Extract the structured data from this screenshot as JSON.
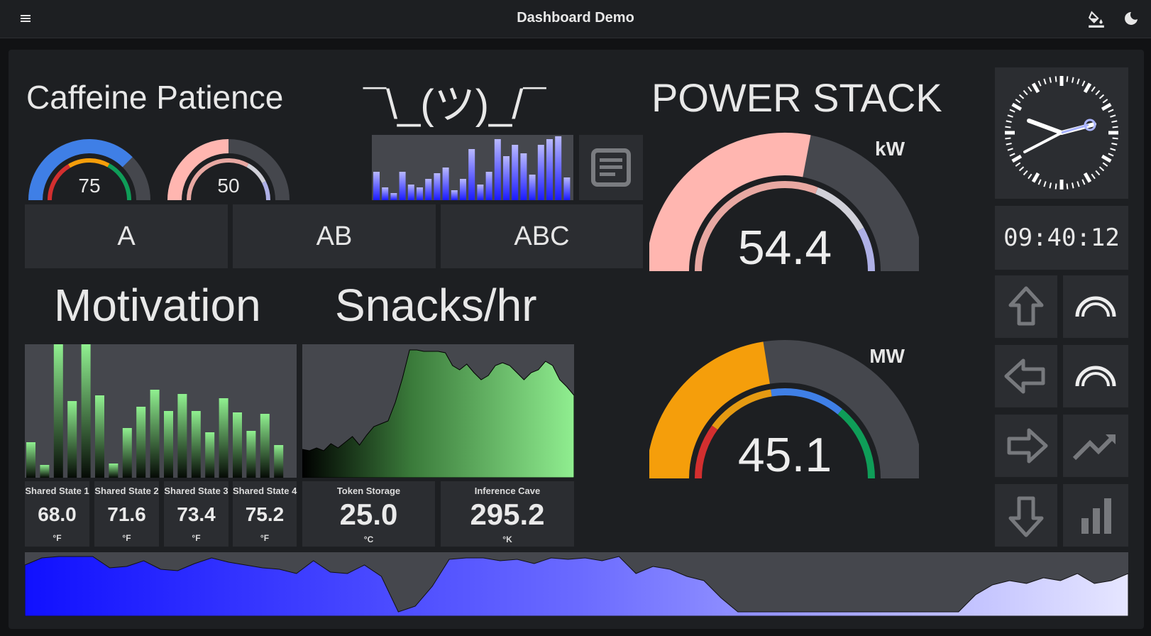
{
  "app": {
    "title": "Dashboard Demo"
  },
  "icons": {
    "menu": "menu-icon",
    "theme_paint": "format-color-fill-icon",
    "dark_mode": "moon-icon",
    "notes": "notes-icon"
  },
  "caffeine": {
    "title": "Caffeine Patience",
    "gauge1_value": "75",
    "gauge2_value": "50",
    "gauge1_level": 0.75,
    "gauge2_level": 0.5
  },
  "shrug": {
    "title": "¯\\_(ツ)_/¯"
  },
  "buttons": {
    "a": "A",
    "ab": "AB",
    "abc": "ABC"
  },
  "power": {
    "title": "POWER STACK",
    "kw_unit": "kW",
    "kw_value": "54.4",
    "kw_level": 0.56,
    "mw_unit": "MW",
    "mw_value": "45.1",
    "mw_level": 0.45
  },
  "clock": {
    "time": "09:40:12"
  },
  "motivation": {
    "title": "Motivation"
  },
  "snacks": {
    "title": "Snacks/hr"
  },
  "shared_states": [
    {
      "label": "Shared State 1",
      "value": "68.0",
      "unit": "°F"
    },
    {
      "label": "Shared State 2",
      "value": "71.6",
      "unit": "°F"
    },
    {
      "label": "Shared State 3",
      "value": "73.4",
      "unit": "°F"
    },
    {
      "label": "Shared State 4",
      "value": "75.2",
      "unit": "°F"
    }
  ],
  "token_storage": {
    "label": "Token Storage",
    "value": "25.0",
    "unit": "°C"
  },
  "inference_cave": {
    "label": "Inference Cave",
    "value": "295.2",
    "unit": "°K"
  },
  "side_icons": [
    "arrow-up-icon",
    "gauge-arc-icon",
    "arrow-left-icon",
    "gauge-arc-icon",
    "arrow-right-icon",
    "trending-up-icon",
    "arrow-down-icon",
    "bar-chart-icon"
  ],
  "colors": {
    "blue": "#3f7fe6",
    "pink": "#ffb6b0",
    "orange": "#f59e0b",
    "green": "#0f9d58",
    "red": "#d32f2f",
    "lavender": "#aeb0e6",
    "track": "#45474d"
  }
}
